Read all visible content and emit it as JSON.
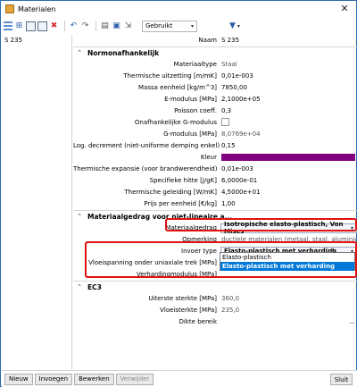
{
  "window": {
    "title": "Materialen",
    "close_glyph": "✕"
  },
  "toolbar": {
    "icons": [
      "table-icon",
      "add-icon",
      "edit-icon",
      "copy-icon",
      "delete-icon",
      "undo-icon",
      "redo-icon",
      "open-icon",
      "save-icon",
      "import-icon"
    ],
    "combo_value": "Gebruikt",
    "combo_arrow": "▾",
    "filter_arrow": "▾"
  },
  "left_list": {
    "items": [
      "S 235"
    ]
  },
  "props": {
    "naam_label": "Naam",
    "naam_value": "S 235",
    "sec1_title": "Normonafhankelijk",
    "sec1_chev": "⌃",
    "rows1": [
      {
        "label": "Materiaaltype",
        "value": "Staal",
        "muted": true
      },
      {
        "label": "Thermische uitzetting [m/mK]",
        "value": "0,01e-003"
      },
      {
        "label": "Massa eenheid [kg/m^3]",
        "value": "7850,00"
      },
      {
        "label": "E-modulus [MPa]",
        "value": "2,1000e+05"
      },
      {
        "label": "Poisson coeff.",
        "value": "0,3"
      }
    ],
    "onafh_label": "Onafhankelijke G-modulus",
    "g_label": "G-modulus [MPa]",
    "g_value": "8,0769e+04",
    "logdec_label": "Log. decrement (niet-uniforme demping enkel)",
    "logdec_value": "0,15",
    "kleur_label": "Kleur",
    "kleur_color": "#800080",
    "rows2": [
      {
        "label": "Thermische expansie (voor brandwerendheid)",
        "value": "0,01e-003"
      },
      {
        "label": "Specifieke hitte [J/gK]",
        "value": "6,0000e-01"
      },
      {
        "label": "Thermische geleiding [W/mK]",
        "value": "4,5000e+01"
      },
      {
        "label": "Prijs per eenheid [€/kg]",
        "value": "1,00"
      }
    ],
    "sec2_title": "Materiaalgedrag voor niet-lineaire a...",
    "sec2_chev": "⌃",
    "gedrag_label": "Materiaalgedrag",
    "gedrag_value": "Isotropische elasto-plastisch, Von Mises",
    "gedrag_arrow": "▾",
    "opm_label": "Opmerking",
    "opm_value": "ductiele materialen (metaal, staal, aluminium",
    "invoer_label": "Invoer type",
    "invoer_value": "Elasto-plastisch met verharding",
    "invoer_arrow": "▾",
    "vloei_label": "Vloeispanning onder uniaxiale trek [MPa]",
    "verh_label": "Verhardingmodulus [MPa]",
    "dropdown_options": [
      "Elasto-plastisch",
      "Elasto-plastisch met verharding"
    ],
    "sec3_title": "EC3",
    "sec3_chev": "⌃",
    "rows3": [
      {
        "label": "Uiterste sterkte [MPa]",
        "value": "360,0"
      },
      {
        "label": "Vloeisterkte [MPa]",
        "value": "235,0"
      }
    ],
    "dikte_label": "Dikte bereik",
    "dikte_btn": "..."
  },
  "bottom": {
    "buttons": [
      "Nieuw",
      "Invoegen",
      "Bewerken",
      "Verwijder"
    ],
    "close": "Sluit"
  },
  "colors": {
    "accent": "#0078d7",
    "highlight": "#e01010"
  }
}
